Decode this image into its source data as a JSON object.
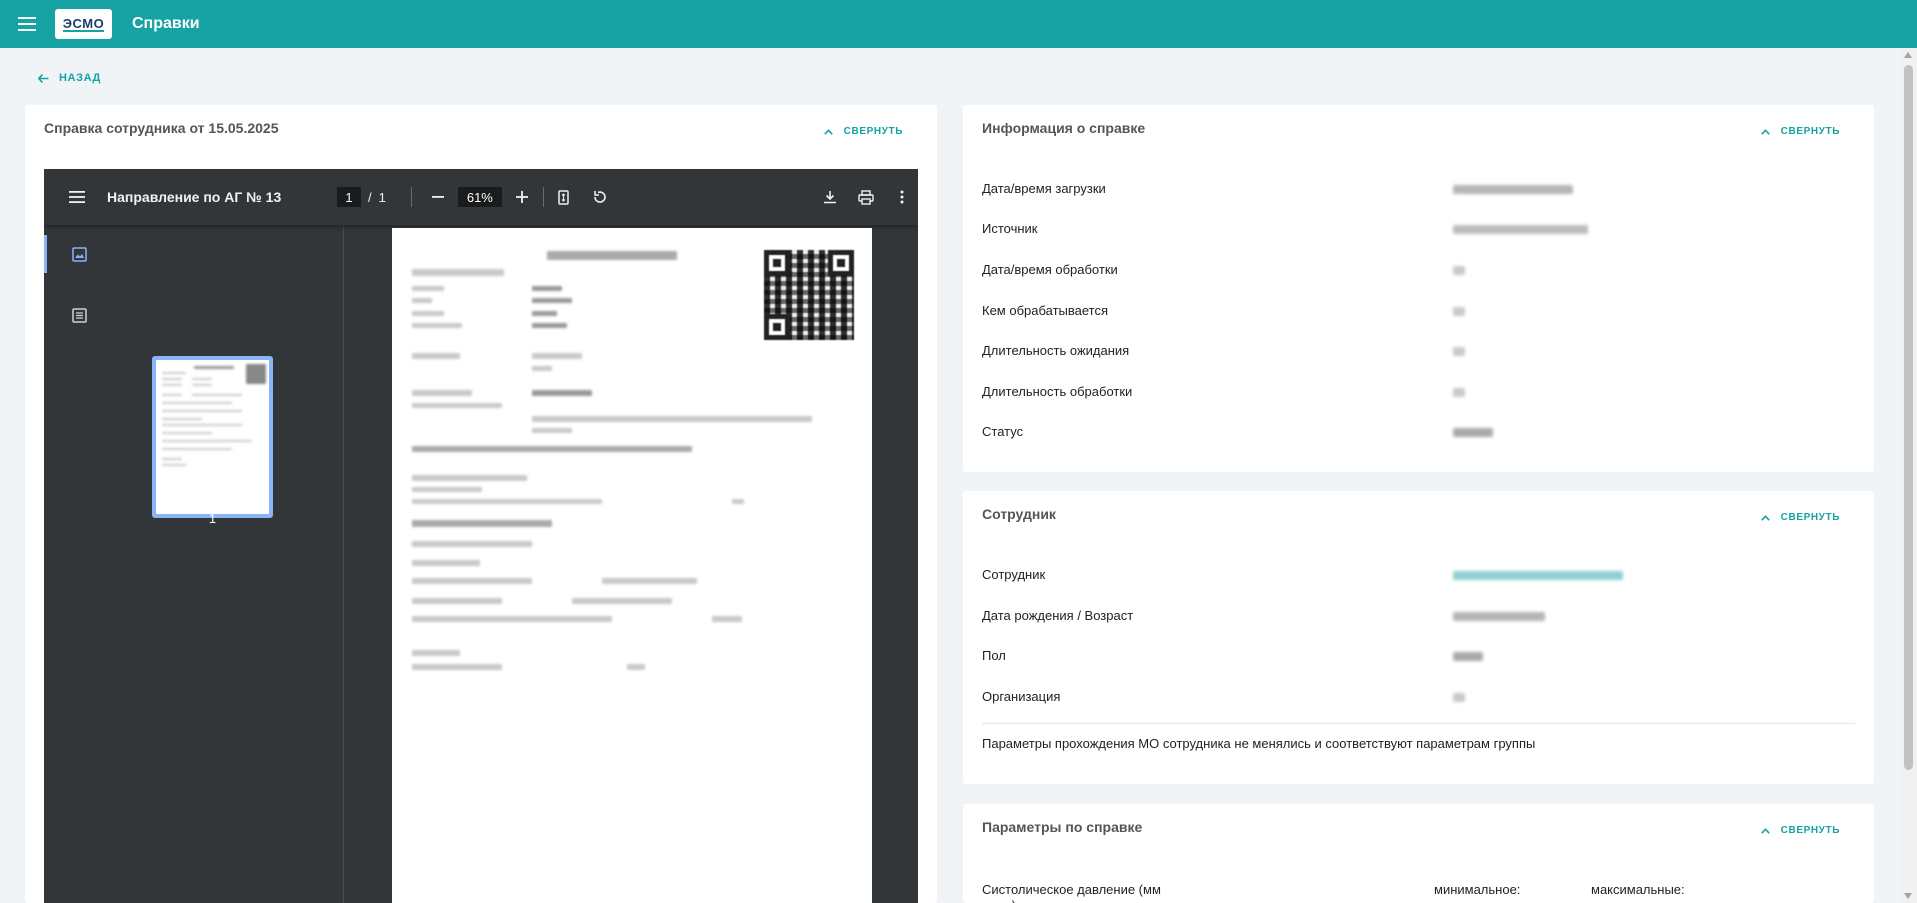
{
  "header": {
    "logo_text": "ЭСМО",
    "title": "Справки"
  },
  "back": {
    "label": "НАЗАД"
  },
  "doc_card": {
    "title": "Справка сотрудника от 15.05.2025",
    "collapse_label": "СВЕРНУТЬ",
    "viewer": {
      "doc_title": "Направление по АГ № 13",
      "current_page": "1",
      "page_sep": "/",
      "total_pages": "1",
      "zoom": "61%",
      "thumb_number": "1",
      "icons": [
        "menu-icon",
        "minus-icon",
        "plus-icon",
        "fit-page-icon",
        "rotate-icon",
        "download-icon",
        "print-icon",
        "more-vert-icon",
        "thumbnails-icon",
        "outline-icon"
      ]
    }
  },
  "info_card": {
    "title": "Информация о справке",
    "collapse_label": "СВЕРНУТЬ",
    "rows": [
      {
        "label": "Дата/время загрузки"
      },
      {
        "label": "Источник"
      },
      {
        "label": "Дата/время обработки"
      },
      {
        "label": "Кем обрабатывается"
      },
      {
        "label": "Длительность ожидания"
      },
      {
        "label": "Длительность обработки"
      },
      {
        "label": "Статус"
      }
    ]
  },
  "employee_card": {
    "title": "Сотрудник",
    "collapse_label": "СВЕРНУТЬ",
    "rows": [
      {
        "label": "Сотрудник"
      },
      {
        "label": "Дата рождения / Возраст"
      },
      {
        "label": "Пол"
      },
      {
        "label": "Организация"
      }
    ],
    "note": "Параметры прохождения МО сотрудника не менялись и соответствуют параметрам группы"
  },
  "params_card": {
    "title": "Параметры по справке",
    "collapse_label": "СВЕРНУТЬ",
    "row_label": "Систолическое давление (мм рт.ст.)",
    "min_label": "минимальное:",
    "max_label": "максимальные:"
  },
  "colors": {
    "brand": "#17a2a4",
    "viewer_bg": "#323639",
    "link_value": "#8fd0d2"
  }
}
